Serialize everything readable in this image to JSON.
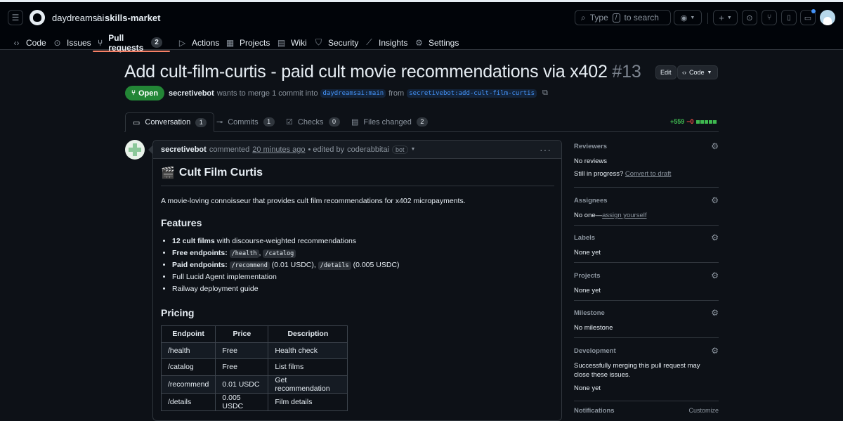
{
  "header": {
    "owner": "daydreamsai",
    "separator": "/",
    "repo": "skills-market",
    "search_prefix": "Type",
    "search_key": "/",
    "search_suffix": "to search"
  },
  "nav": [
    {
      "label": "Code",
      "icon": "code-icon"
    },
    {
      "label": "Issues",
      "icon": "issue-icon"
    },
    {
      "label": "Pull requests",
      "icon": "pull-request-icon",
      "count": "2"
    },
    {
      "label": "Actions",
      "icon": "play-icon"
    },
    {
      "label": "Projects",
      "icon": "table-icon"
    },
    {
      "label": "Wiki",
      "icon": "book-icon"
    },
    {
      "label": "Security",
      "icon": "shield-icon"
    },
    {
      "label": "Insights",
      "icon": "graph-icon"
    },
    {
      "label": "Settings",
      "icon": "gear-icon"
    }
  ],
  "pr": {
    "title": "Add cult-film-curtis - paid cult movie recommendations via x402",
    "number": "#13",
    "edit_label": "Edit",
    "code_label": "Code",
    "state": "Open",
    "author": "secretivebot",
    "merge_text": "wants to merge 1 commit into",
    "base_branch": "daydreamsai:main",
    "from_text": "from",
    "head_branch": "secretivebot:add-cult-film-curtis"
  },
  "tabs": [
    {
      "label": "Conversation",
      "count": "1"
    },
    {
      "label": "Commits",
      "count": "1"
    },
    {
      "label": "Checks",
      "count": "0"
    },
    {
      "label": "Files changed",
      "count": "2"
    }
  ],
  "diffstat": {
    "additions": "+559",
    "deletions": "−0"
  },
  "comment": {
    "author": "secretivebot",
    "action": "commented",
    "time": "20 minutes ago",
    "edited_prefix": "• edited by",
    "editor": "coderabbitai",
    "bot_label": "bot",
    "heading_emoji": "🎬",
    "heading": "Cult Film Curtis",
    "intro": "A movie-loving connoisseur that provides cult film recommendations for x402 micropayments.",
    "features_heading": "Features",
    "features": {
      "f1_bold": "12 cult films",
      "f1_rest": "with discourse-weighted recommendations",
      "f2_bold": "Free endpoints:",
      "f2_code1": "/health",
      "f2_comma": ",",
      "f2_code2": "/catalog",
      "f3_bold": "Paid endpoints:",
      "f3_code1": "/recommend",
      "f3_mid": "(0.01 USDC),",
      "f3_code2": "/details",
      "f3_end": "(0.005 USDC)",
      "f4": "Full Lucid Agent implementation",
      "f5": "Railway deployment guide"
    },
    "pricing_heading": "Pricing",
    "pricing_table": {
      "headers": [
        "Endpoint",
        "Price",
        "Description"
      ],
      "rows": [
        [
          "/health",
          "Free",
          "Health check"
        ],
        [
          "/catalog",
          "Free",
          "List films"
        ],
        [
          "/recommend",
          "0.01 USDC",
          "Get recommendation"
        ],
        [
          "/details",
          "0.005 USDC",
          "Film details"
        ]
      ]
    }
  },
  "sidebar": {
    "reviewers_title": "Reviewers",
    "reviewers_value": "No reviews",
    "progress_text": "Still in progress?",
    "convert_link": "Convert to draft",
    "assignees_title": "Assignees",
    "assignees_value": "No one—",
    "assign_link": "assign yourself",
    "labels_title": "Labels",
    "labels_value": "None yet",
    "projects_title": "Projects",
    "projects_value": "None yet",
    "milestone_title": "Milestone",
    "milestone_value": "No milestone",
    "development_title": "Development",
    "development_text": "Successfully merging this pull request may close these issues.",
    "development_value": "None yet",
    "notifications_title": "Notifications",
    "customize_label": "Customize"
  }
}
